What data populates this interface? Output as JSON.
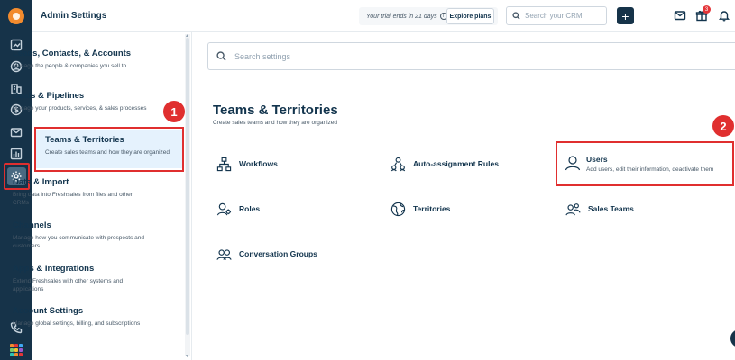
{
  "header": {
    "title": "Admin Settings",
    "trial_text": "Your trial ends in 21 days",
    "info_glyph": "i",
    "explore_label": "Explore plans",
    "search_placeholder": "Search your CRM",
    "plus_glyph": "+",
    "notification_count": "3"
  },
  "rail": {
    "icons": [
      "logo-icon",
      "dashboard-icon",
      "contacts-icon",
      "accounts-icon",
      "deals-icon",
      "email-icon",
      "reports-icon",
      "settings-icon",
      "phone-icon",
      "apps-grid-icon"
    ],
    "grid_colors": [
      "#f28b2e",
      "#e43538",
      "#3fa9f5",
      "#7bc96f",
      "#f2c12e",
      "#9b59d0",
      "#2ec4b6",
      "#f28b2e",
      "#e43538"
    ]
  },
  "sidebar": {
    "items": [
      {
        "label": "Leads, Contacts, & Accounts",
        "desc": "Manage the people & companies you sell to"
      },
      {
        "label": "Deals & Pipelines",
        "desc": "Manage your products, services, & sales processes"
      },
      {
        "label": "Teams & Territories",
        "desc": "Create sales teams and how they are organized"
      },
      {
        "label": "Data & Import",
        "desc": "Bring data into Freshsales from files and other CRMs"
      },
      {
        "label": "Channels",
        "desc": "Manage how you communicate with prospects and customers"
      },
      {
        "label": "Apps & Integrations",
        "desc": "Extend Freshsales with other systems and applications"
      },
      {
        "label": "Account Settings",
        "desc": "Manage global settings, billing, and subscriptions"
      }
    ],
    "arrow_up": "▲",
    "arrow_down": "▼"
  },
  "markers": {
    "one": "1",
    "two": "2"
  },
  "main": {
    "search_placeholder": "Search settings",
    "title": "Teams & Territories",
    "subtitle": "Create sales teams and how they are organized",
    "cards": [
      {
        "label": "Workflows",
        "icon": "workflow-icon"
      },
      {
        "label": "Auto-assignment Rules",
        "icon": "auto-assign-icon"
      },
      {
        "label": "Roles",
        "icon": "roles-icon"
      },
      {
        "label": "Territories",
        "icon": "globe-icon"
      },
      {
        "label": "Sales Teams",
        "icon": "team-icon"
      },
      {
        "label": "Conversation Groups",
        "icon": "group-icon"
      }
    ],
    "users": {
      "label": "Users",
      "desc": "Add users, edit their information, deactivate them",
      "icon": "user-icon"
    }
  },
  "colors": {
    "highlight": "#e02f2f",
    "rail": "#163349",
    "selected_bg": "#e5f2fd"
  }
}
